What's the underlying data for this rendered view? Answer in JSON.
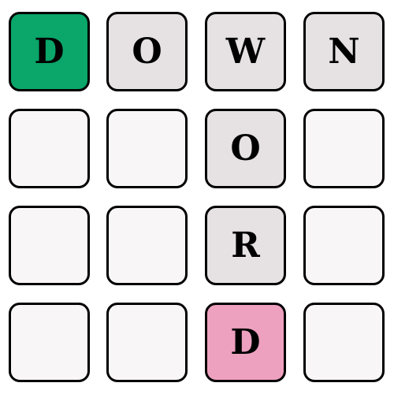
{
  "puzzle": {
    "across_word": "DOWN",
    "down_word": "WORD",
    "colors": {
      "start": "#0aa66a",
      "end": "#eea0bf",
      "filled": "#e6e1e2",
      "empty": "#f8f6f7",
      "border": "#000000"
    },
    "rows": [
      [
        {
          "letter": "D",
          "state": "start"
        },
        {
          "letter": "O",
          "state": "filled"
        },
        {
          "letter": "W",
          "state": "filled"
        },
        {
          "letter": "N",
          "state": "filled"
        }
      ],
      [
        {
          "letter": "",
          "state": "empty"
        },
        {
          "letter": "",
          "state": "empty"
        },
        {
          "letter": "O",
          "state": "filled"
        },
        {
          "letter": "",
          "state": "empty"
        }
      ],
      [
        {
          "letter": "",
          "state": "empty"
        },
        {
          "letter": "",
          "state": "empty"
        },
        {
          "letter": "R",
          "state": "filled"
        },
        {
          "letter": "",
          "state": "empty"
        }
      ],
      [
        {
          "letter": "",
          "state": "empty"
        },
        {
          "letter": "",
          "state": "empty"
        },
        {
          "letter": "D",
          "state": "end"
        },
        {
          "letter": "",
          "state": "empty"
        }
      ]
    ]
  }
}
